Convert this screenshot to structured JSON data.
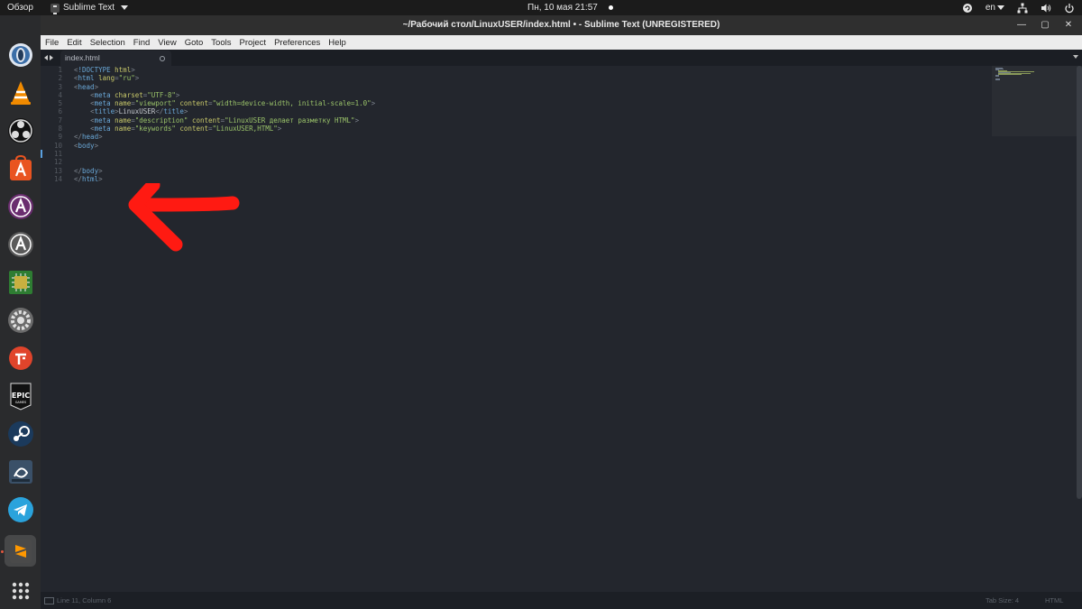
{
  "topbar": {
    "activities": "Обзор",
    "app_name": "Sublime Text",
    "clock": "Пн, 10 мая  21:57",
    "lang": "en"
  },
  "dock": {
    "items": [
      "opera-gx",
      "vlc",
      "obs-studio",
      "ubuntu-software",
      "app-installer",
      "app-installer-2",
      "cpu-monitor",
      "settings-gear",
      "fingerprint-app",
      "epic-games",
      "steam",
      "battle-net",
      "telegram",
      "sublime-text",
      "show-apps"
    ]
  },
  "window": {
    "title": "~/Рабочий стол/LinuxUSER/index.html • - Sublime Text (UNREGISTERED)"
  },
  "menu": [
    "File",
    "Edit",
    "Selection",
    "Find",
    "View",
    "Goto",
    "Tools",
    "Project",
    "Preferences",
    "Help"
  ],
  "tab": {
    "name": "index.html"
  },
  "editor": {
    "line_numbers": [
      "1",
      "2",
      "3",
      "4",
      "5",
      "6",
      "7",
      "8",
      "9",
      "10",
      "11",
      "12",
      "13",
      "14"
    ],
    "lines": [
      "<!DOCTYPE html>",
      "<html lang=\"ru\">",
      "<head>",
      "    <meta charset=\"UTF-8\">",
      "    <meta name=\"viewport\" content=\"width=device-width, initial-scale=1.0\">",
      "    <title>LinuxUSER</title>",
      "    <meta name=\"description\" content=\"LinuxUSER делает разметку HTML\">",
      "    <meta name=\"keywords\" content=\"LinuxUSER,HTML\">",
      "</head>",
      "<body>",
      "",
      "",
      "</body>",
      "</html>"
    ]
  },
  "status": {
    "position": "Line 11, Column 6",
    "tab_size": "Tab Size: 4",
    "syntax": "HTML"
  },
  "colors": {
    "annotation_arrow": "#ff1a12",
    "editor_bg": "#23262d",
    "dock_bg": "#2a2b2d"
  }
}
